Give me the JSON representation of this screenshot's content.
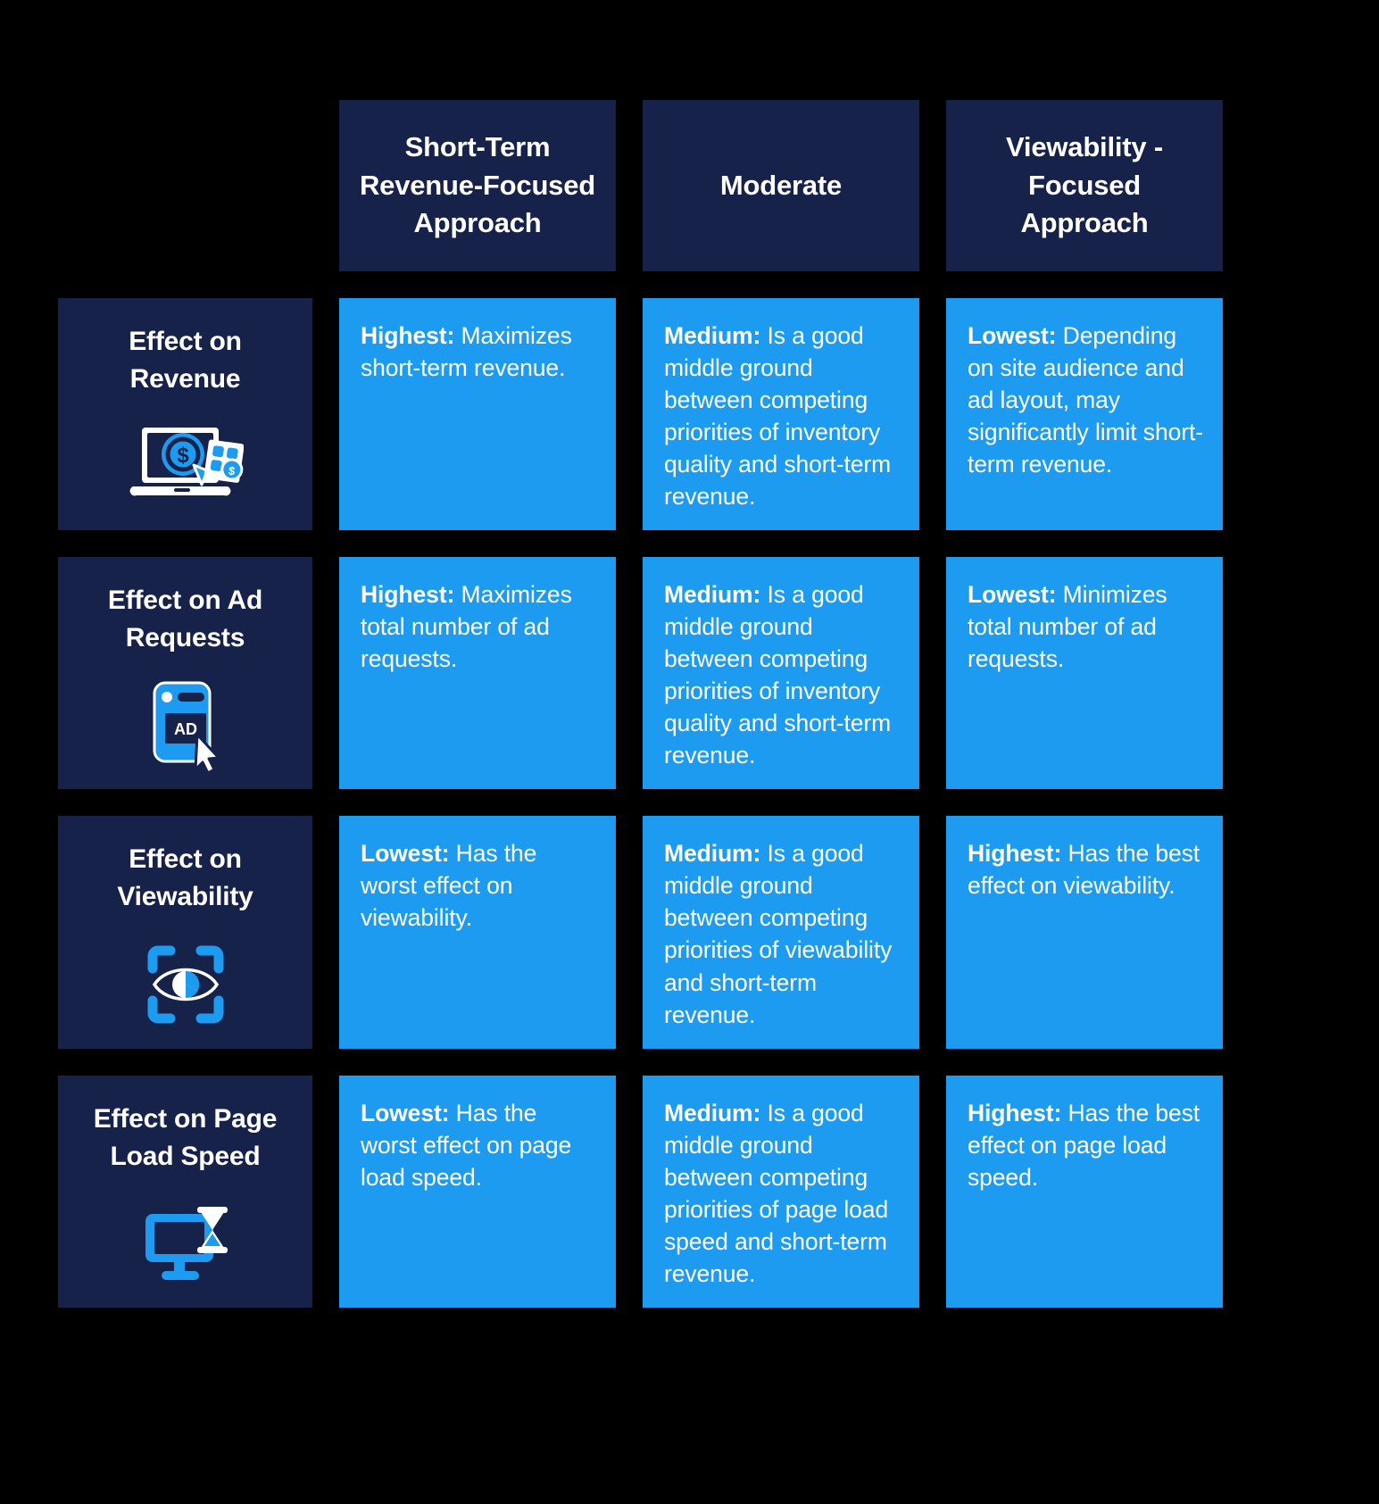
{
  "colors": {
    "background": "#000000",
    "navy": "#16224a",
    "blue": "#1d9bf0",
    "text": "#ffffff"
  },
  "table": {
    "corner_label": "",
    "column_headers": [
      "Short-Term Revenue-Focused Approach",
      "Moderate",
      "Viewability - Focused Approach"
    ],
    "rows": [
      {
        "label": "Effect on Revenue",
        "icon": "laptop-dollar-coin-icon",
        "cells": [
          {
            "lead": "Highest:",
            "text": " Maximizes short-term revenue."
          },
          {
            "lead": "Medium:",
            "text": " Is a good middle ground between competing priorities of inventory quality and short-term revenue."
          },
          {
            "lead": "Lowest:",
            "text": " Depending on site audience and ad layout, may significantly limit short-term revenue."
          }
        ]
      },
      {
        "label": "Effect on Ad Requests",
        "icon": "ad-banner-cursor-icon",
        "cells": [
          {
            "lead": "Highest:",
            "text": " Maximizes total number of ad requests."
          },
          {
            "lead": "Medium:",
            "text": " Is a good middle ground between competing priorities of inventory quality and short-term revenue."
          },
          {
            "lead": "Lowest:",
            "text": " Minimizes total number of ad requests."
          }
        ]
      },
      {
        "label": "Effect on Viewability",
        "icon": "eye-viewfinder-icon",
        "cells": [
          {
            "lead": "Lowest:",
            "text": " Has the worst effect on viewability."
          },
          {
            "lead": "Medium:",
            "text": " Is a good middle ground between competing priorities of viewability and short-term revenue."
          },
          {
            "lead": "Highest:",
            "text": " Has the best effect on viewability."
          }
        ]
      },
      {
        "label": "Effect on Page Load Speed",
        "icon": "monitor-hourglass-icon",
        "cells": [
          {
            "lead": "Lowest:",
            "text": " Has the worst effect on page load speed."
          },
          {
            "lead": "Medium:",
            "text": " Is a good middle ground between competing priorities of page load speed and short-term revenue."
          },
          {
            "lead": "Highest:",
            "text": " Has the best effect on page load speed."
          }
        ]
      }
    ]
  }
}
